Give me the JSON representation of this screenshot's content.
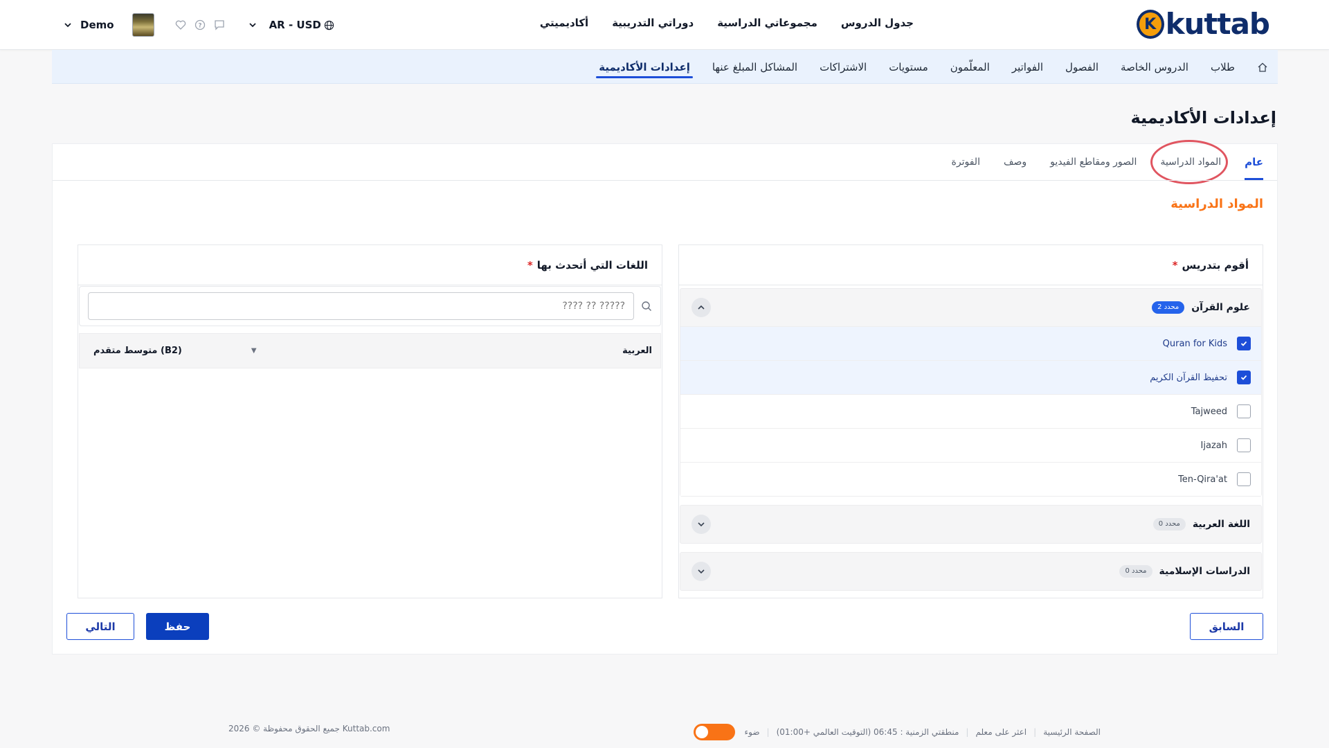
{
  "brand": {
    "name": "kuttab",
    "mark": "K",
    "colors": {
      "primary": "#0f2d6b",
      "accent": "#f97316",
      "link": "#1d4ed8"
    }
  },
  "header": {
    "main_nav": [
      "جدول الدروس",
      "مجموعاتي الدراسية",
      "دوراتي التدريبية",
      "أكاديميتي"
    ],
    "currency": "AR - USD",
    "user_name": "Demo",
    "icons": [
      "home-icon",
      "globe-icon",
      "chevron-down-icon",
      "chat-icon",
      "help-icon",
      "heart-icon"
    ]
  },
  "subnav": {
    "items": [
      "طلاب",
      "الدروس الخاصة",
      "الفصول",
      "الفواتير",
      "المعلّمون",
      "مستويات",
      "الاشتراكات",
      "المشاكل المبلغ عنها",
      "إعدادات الأكاديمية"
    ],
    "active_index": 8
  },
  "page": {
    "title": "إعدادات الأكاديمية"
  },
  "tabs": {
    "items": [
      "عام",
      "المواد الدراسية",
      "الصور ومقاطع الفيديو",
      "وصف",
      "الفوترة"
    ],
    "active_index": 0
  },
  "section": {
    "title": "المواد الدراسية"
  },
  "subjects_panel": {
    "label": "أقوم بتدريس",
    "required_mark": "*",
    "groups": [
      {
        "title": "علوم القرآن",
        "badge": "2 محدد",
        "expanded": true,
        "options": [
          {
            "label": "Quran for Kids",
            "checked": true
          },
          {
            "label": "تحفيظ القرآن الكريم",
            "checked": true
          },
          {
            "label": "Tajweed",
            "checked": false
          },
          {
            "label": "Ijazah",
            "checked": false
          },
          {
            "label": "Ten-Qira'at",
            "checked": false
          }
        ]
      },
      {
        "title": "اللغة العربية",
        "badge": "0 محدد",
        "expanded": false,
        "options": []
      },
      {
        "title": "الدراسات الإسلامية",
        "badge": "0 محدد",
        "expanded": false,
        "options": []
      }
    ]
  },
  "languages_panel": {
    "label": "اللغات التي أتحدث بها",
    "required_mark": "*",
    "search_placeholder": "????? ?? ????",
    "rows": [
      {
        "language": "العربية",
        "level": "متوسط متقدم (B2)"
      }
    ]
  },
  "buttons": {
    "previous": "السابق",
    "save": "حفظ",
    "next": "التالي"
  },
  "footer": {
    "links": [
      "الصفحة الرئيسية",
      "اعثر على معلم"
    ],
    "timezone": "منطقتي الزمنية : 06:45 (التوقيت العالمي +01:00)",
    "theme_label": "ضوء",
    "copyright": "جميع الحقوق محفوظة © 2026 Kuttab.com"
  }
}
